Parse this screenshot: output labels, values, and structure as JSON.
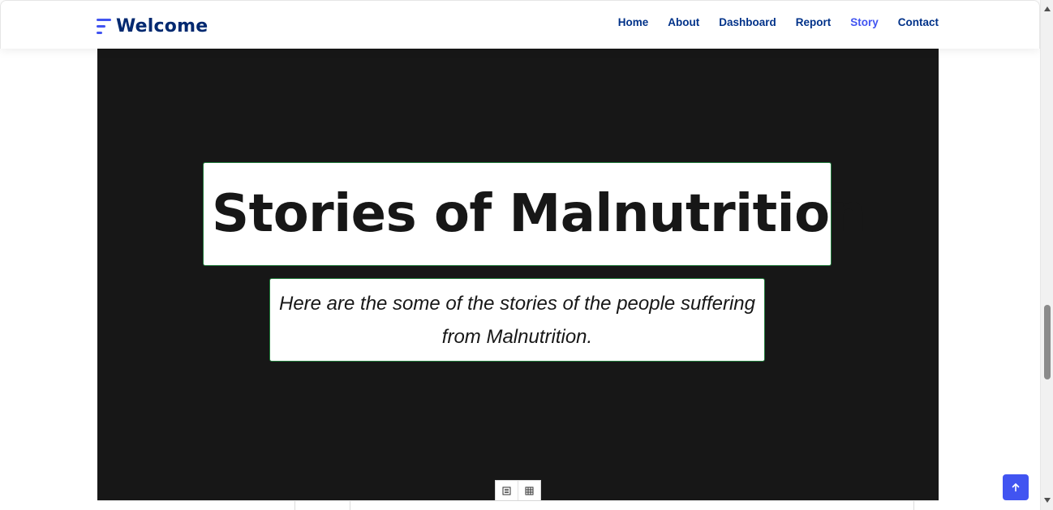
{
  "header": {
    "brand": "Welcome",
    "nav": [
      {
        "label": "Home"
      },
      {
        "label": "About"
      },
      {
        "label": "Dashboard"
      },
      {
        "label": "Report"
      },
      {
        "label": "Story",
        "active": true
      },
      {
        "label": "Contact"
      }
    ]
  },
  "hero": {
    "title": "Stories of Malnutrition",
    "subtitle": "Here are the some of the stories of the people suffering from Malnutrition."
  },
  "toolbar": {
    "icons": [
      "list-view-icon",
      "grid-view-icon"
    ]
  },
  "colors": {
    "brand": "#012970",
    "accent": "#4154f1",
    "hero_bg": "#171717",
    "box_border": "#1f7a3a"
  },
  "icons": {
    "back_to_top": "arrow-up-icon",
    "brand_logo": "menu-lines-icon"
  }
}
